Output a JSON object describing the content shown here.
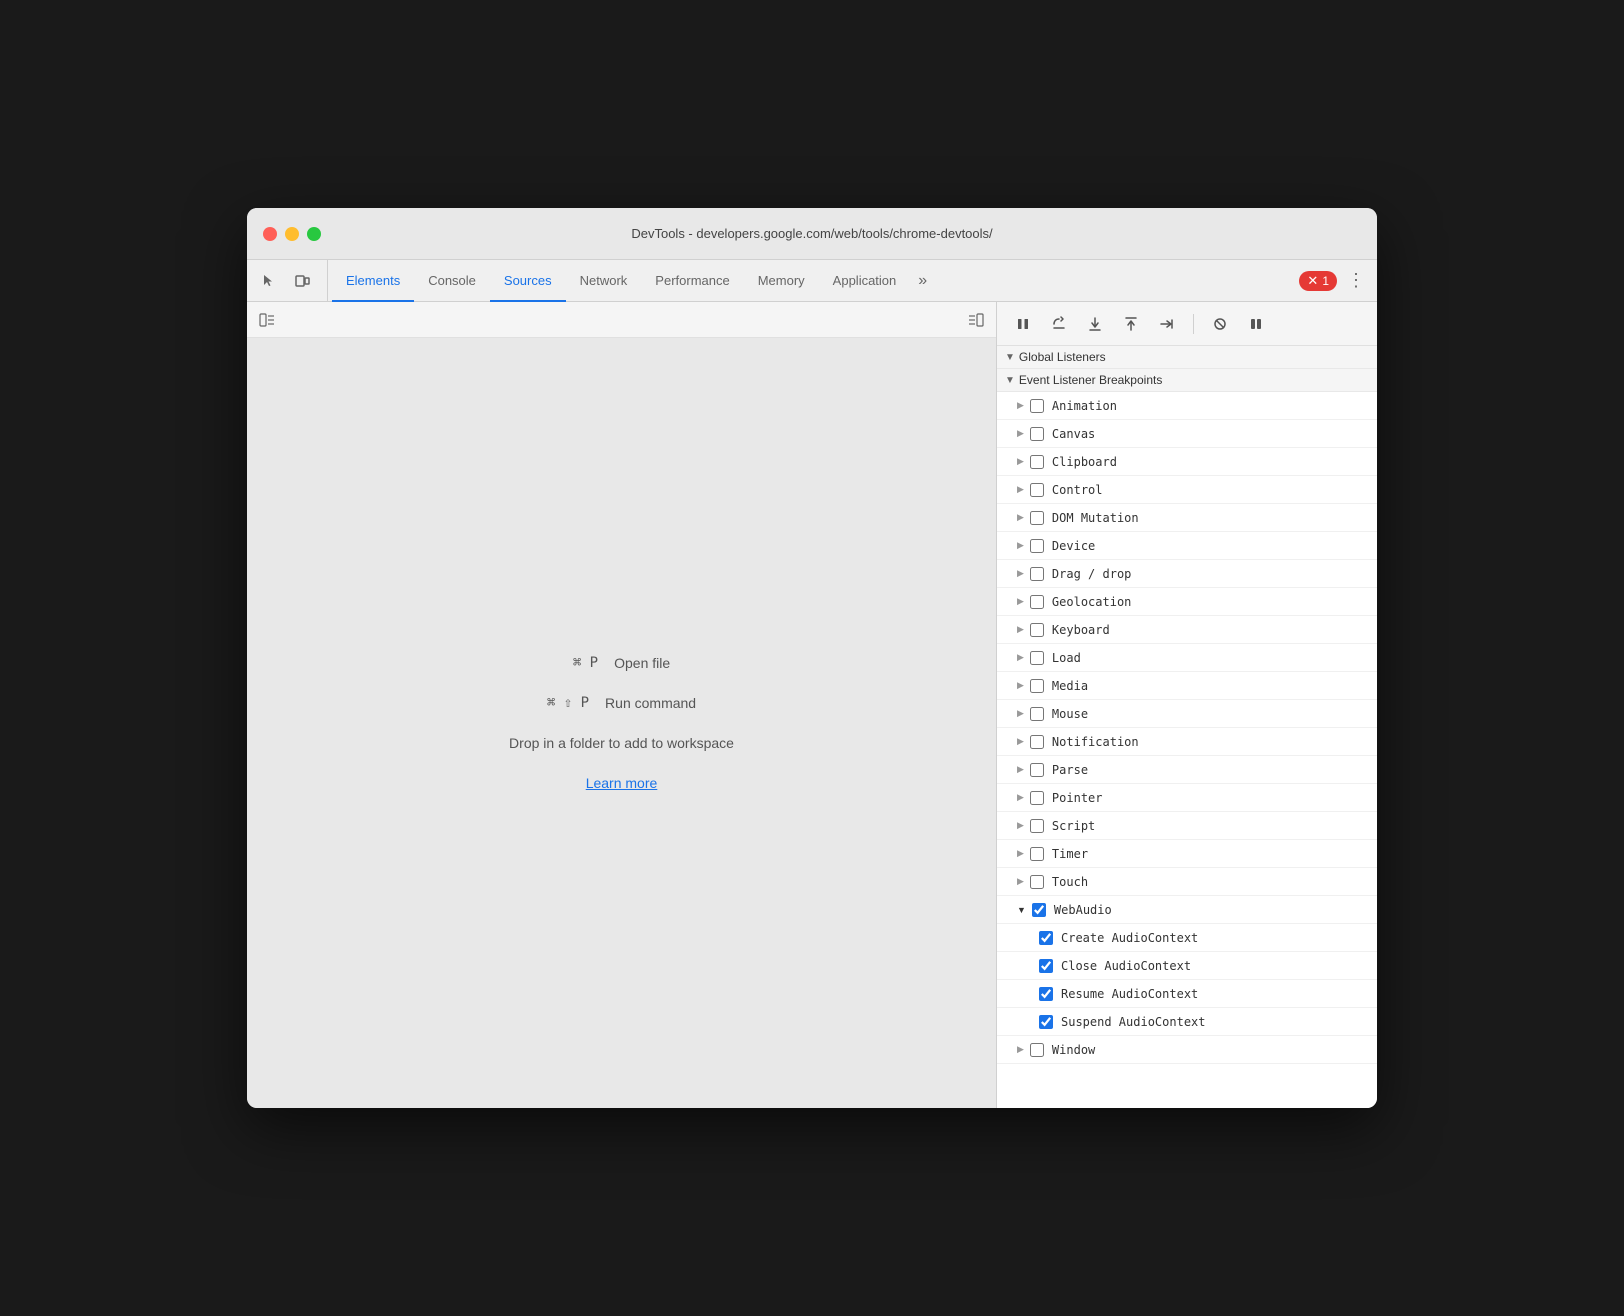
{
  "window": {
    "title": "DevTools - developers.google.com/web/tools/chrome-devtools/"
  },
  "tabs": [
    {
      "id": "elements",
      "label": "Elements",
      "active": false
    },
    {
      "id": "console",
      "label": "Console",
      "active": false
    },
    {
      "id": "sources",
      "label": "Sources",
      "active": true
    },
    {
      "id": "network",
      "label": "Network",
      "active": false
    },
    {
      "id": "performance",
      "label": "Performance",
      "active": false
    },
    {
      "id": "memory",
      "label": "Memory",
      "active": false
    },
    {
      "id": "application",
      "label": "Application",
      "active": false
    }
  ],
  "error_badge": "1",
  "sources_panel": {
    "shortcut1_key": "⌘ P",
    "shortcut1_desc": "Open file",
    "shortcut2_key": "⌘ ⇧ P",
    "shortcut2_desc": "Run command",
    "drop_text": "Drop in a folder to add to workspace",
    "learn_more": "Learn more"
  },
  "debugger": {
    "pause_icon": "⏸",
    "step_over_icon": "↺",
    "step_into_icon": "↓",
    "step_out_icon": "↑",
    "step_icon": "→",
    "deactivate_icon": "⊘",
    "pause_on_exceptions_icon": "⏸"
  },
  "breakpoints": {
    "global_listeners_label": "Global Listeners",
    "event_listener_label": "Event Listener Breakpoints",
    "items": [
      {
        "id": "animation",
        "label": "Animation",
        "checked": false,
        "expanded": false
      },
      {
        "id": "canvas",
        "label": "Canvas",
        "checked": false,
        "expanded": false
      },
      {
        "id": "clipboard",
        "label": "Clipboard",
        "checked": false,
        "expanded": false
      },
      {
        "id": "control",
        "label": "Control",
        "checked": false,
        "expanded": false
      },
      {
        "id": "dom-mutation",
        "label": "DOM Mutation",
        "checked": false,
        "expanded": false
      },
      {
        "id": "device",
        "label": "Device",
        "checked": false,
        "expanded": false
      },
      {
        "id": "drag-drop",
        "label": "Drag / drop",
        "checked": false,
        "expanded": false
      },
      {
        "id": "geolocation",
        "label": "Geolocation",
        "checked": false,
        "expanded": false
      },
      {
        "id": "keyboard",
        "label": "Keyboard",
        "checked": false,
        "expanded": false
      },
      {
        "id": "load",
        "label": "Load",
        "checked": false,
        "expanded": false
      },
      {
        "id": "media",
        "label": "Media",
        "checked": false,
        "expanded": false
      },
      {
        "id": "mouse",
        "label": "Mouse",
        "checked": false,
        "expanded": false
      },
      {
        "id": "notification",
        "label": "Notification",
        "checked": false,
        "expanded": false
      },
      {
        "id": "parse",
        "label": "Parse",
        "checked": false,
        "expanded": false
      },
      {
        "id": "pointer",
        "label": "Pointer",
        "checked": false,
        "expanded": false
      },
      {
        "id": "script",
        "label": "Script",
        "checked": false,
        "expanded": false
      },
      {
        "id": "timer",
        "label": "Timer",
        "checked": false,
        "expanded": false
      },
      {
        "id": "touch",
        "label": "Touch",
        "checked": false,
        "expanded": false
      },
      {
        "id": "webaudio",
        "label": "WebAudio",
        "checked": true,
        "expanded": true
      }
    ],
    "webaudio_children": [
      {
        "id": "create-audiocontext",
        "label": "Create AudioContext",
        "checked": true
      },
      {
        "id": "close-audiocontext",
        "label": "Close AudioContext",
        "checked": true
      },
      {
        "id": "resume-audiocontext",
        "label": "Resume AudioContext",
        "checked": true
      },
      {
        "id": "suspend-audiocontext",
        "label": "Suspend AudioContext",
        "checked": true
      }
    ],
    "window_item": {
      "id": "window",
      "label": "Window",
      "checked": false,
      "expanded": false
    }
  }
}
